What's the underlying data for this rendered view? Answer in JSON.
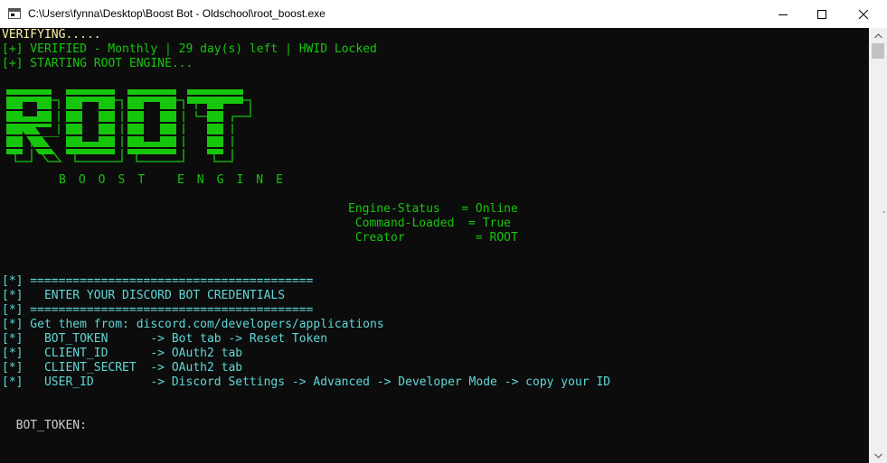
{
  "window": {
    "title": "C:\\Users\\fynna\\Desktop\\Boost Bot - Oldschool\\root_boost.exe"
  },
  "console": {
    "verifying": "VERIFYING.....",
    "verified": "[+] VERIFIED - Monthly | 29 day(s) left | HWID Locked",
    "starting": "[+] STARTING ROOT ENGINE...",
    "logo_text": "ROOT",
    "tagline": "BOOST ENGINE",
    "status": [
      "Engine-Status   = Online",
      " Command-Loaded  = True",
      " Creator          = ROOT"
    ],
    "credentials": [
      "[*] ========================================",
      "[*]   ENTER YOUR DISCORD BOT CREDENTIALS",
      "[*] ========================================",
      "[*] Get them from: discord.com/developers/applications",
      "[*]   BOT_TOKEN      -> Bot tab -> Reset Token",
      "[*]   CLIENT_ID      -> OAuth2 tab",
      "[*]   CLIENT_SECRET  -> OAuth2 tab",
      "[*]   USER_ID        -> Discord Settings -> Advanced -> Developer Mode -> copy your ID"
    ],
    "prompt": "  BOT_TOKEN:"
  },
  "colors": {
    "console_bg": "#0c0c0c",
    "yellow": "#f9f1a5",
    "green": "#16c60c",
    "cyan": "#61d6d6"
  }
}
